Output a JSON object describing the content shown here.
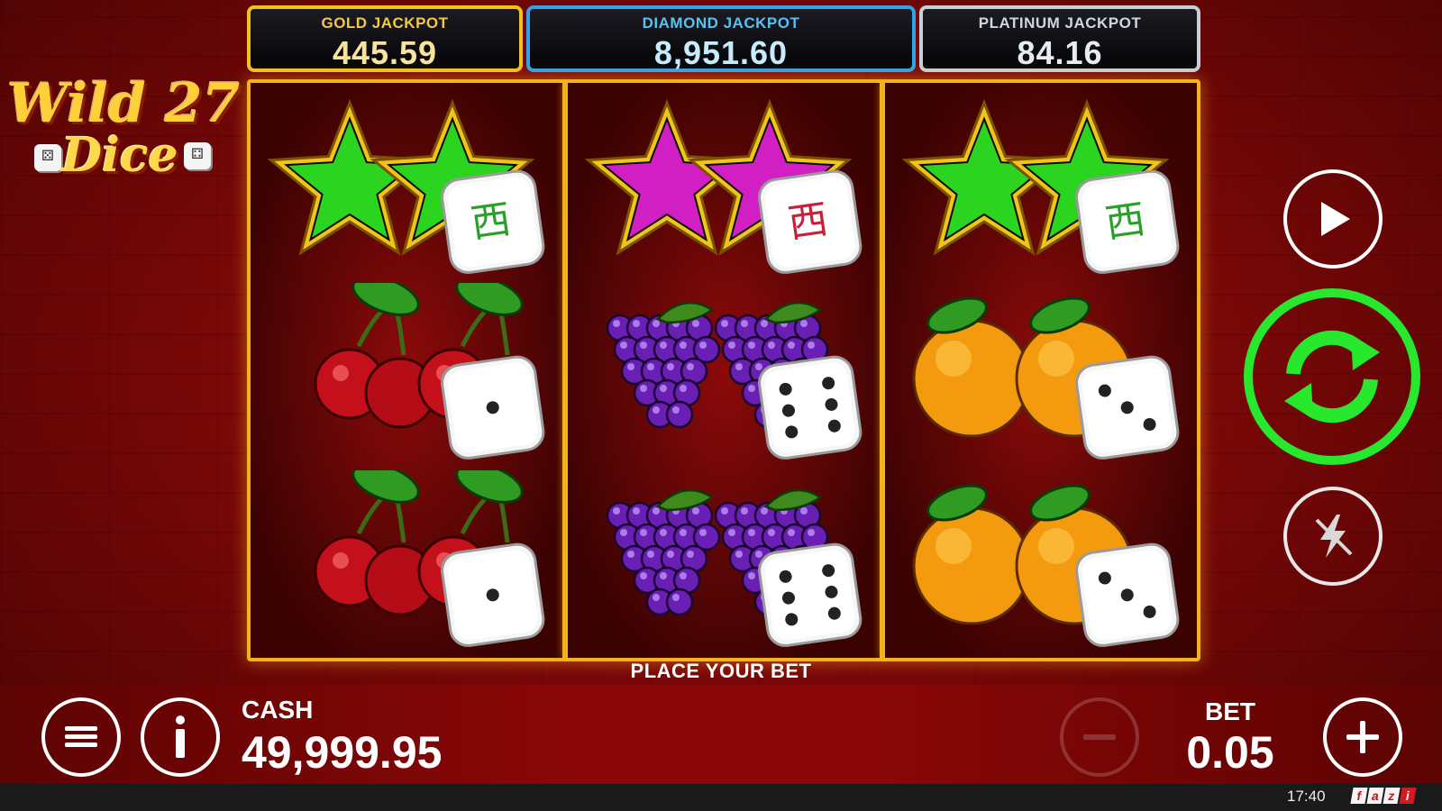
{
  "jackpots": {
    "gold": {
      "label": "GOLD JACKPOT",
      "value": "445.59"
    },
    "diamond": {
      "label": "DIAMOND JACKPOT",
      "value": "8,951.60"
    },
    "platinum": {
      "label": "PLATINUM JACKPOT",
      "value": "84.16"
    }
  },
  "logo": {
    "line1": "Wild 27",
    "line2": "Dice"
  },
  "reels": [
    [
      "green-star",
      "cherries",
      "cherries"
    ],
    [
      "magenta-star",
      "grapes",
      "grapes"
    ],
    [
      "green-star",
      "oranges",
      "oranges"
    ]
  ],
  "colors": {
    "frame": "#f3b21a",
    "spin_button": "#27e82c",
    "background": "#8a0707"
  },
  "status_text": "PLACE YOUR BET",
  "cash": {
    "label": "CASH",
    "value": "49,999.95"
  },
  "bet": {
    "label": "BET",
    "value": "0.05"
  },
  "footer": {
    "time": "17:40",
    "brand_letters": [
      "f",
      "a",
      "z",
      "i"
    ]
  },
  "icons": {
    "play": "play-icon",
    "spin": "refresh-icon",
    "turbo": "lightning-off-icon",
    "menu": "hamburger-icon",
    "info": "info-icon",
    "minus": "minus-icon",
    "plus": "plus-icon"
  }
}
